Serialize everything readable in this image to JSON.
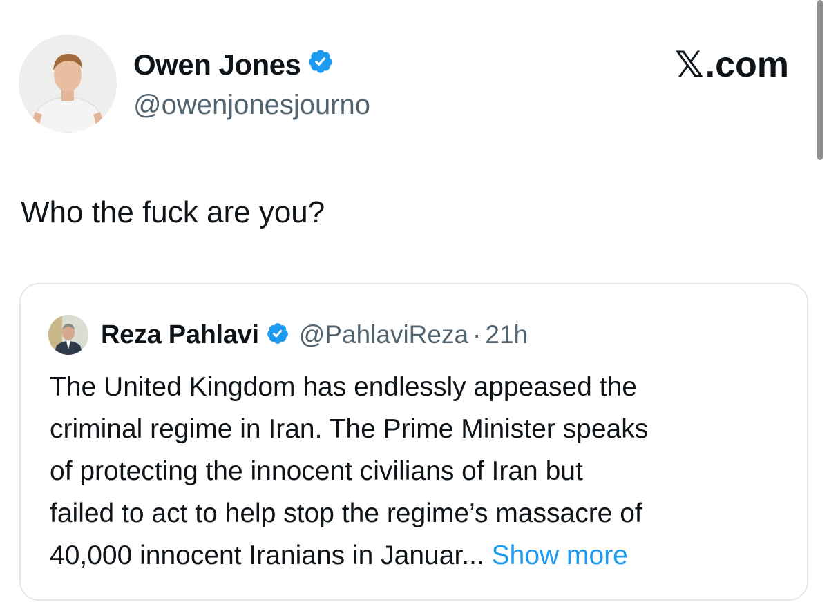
{
  "tweet": {
    "author": {
      "name": "Owen Jones",
      "handle": "@owenjonesjourno",
      "verified": true
    },
    "brand": {
      "symbol": "𝕏",
      "text": ".com"
    },
    "text": "Who the fuck are you?"
  },
  "quoted_tweet": {
    "author": {
      "name": "Reza Pahlavi",
      "handle": "@PahlaviReza",
      "verified": true
    },
    "separator": "·",
    "time": "21h",
    "lines": [
      "The United Kingdom has endlessly appeased the",
      "criminal regime in Iran. The Prime Minister speaks",
      "of protecting the innocent civilians of Iran but",
      "failed to act to help stop the regime’s massacre of",
      "40,000 innocent Iranians in Januar..."
    ],
    "show_more_label": "Show more"
  },
  "colors": {
    "verified_badge": "#1d9bf0",
    "link": "#1d9bf0",
    "secondary_text": "#536471",
    "card_border": "#e5e8eb"
  },
  "icons": {
    "verified": "verified-badge-icon",
    "brand": "x-logo-icon"
  }
}
